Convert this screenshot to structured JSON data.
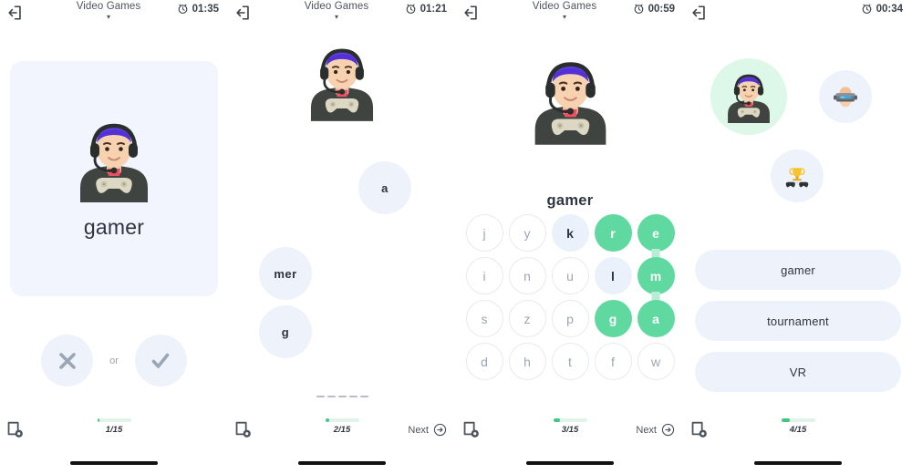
{
  "accent": {
    "green": "#5fd9a0",
    "green_dark": "#3ec87f",
    "green_light": "#ddf7e9",
    "blue_light": "#eef3fb",
    "card_blue": "#f2f5fd",
    "text_dark": "#2e3440",
    "text_muted": "#9aa6b5"
  },
  "screens": [
    {
      "id": "flashcard-screen",
      "header": {
        "exit_icon": "exit-icon",
        "title": "Video Games",
        "caret_icon": "chevron-down-icon",
        "clock_icon": "alarm-clock-icon",
        "timer": "01:35"
      },
      "card": {
        "word": "gamer",
        "avatar_icon": "gamer-avatar"
      },
      "choices": {
        "reject_icon": "close-icon",
        "or_label": "or",
        "accept_icon": "check-icon"
      },
      "footer": {
        "card_settings_icon": "card-settings-icon",
        "progress_label": "1/15",
        "progress_percent": 7,
        "next_label": "",
        "next_icon": "arrow-right-circle-icon",
        "show_next": false
      }
    },
    {
      "id": "word-bubbles-screen",
      "header": {
        "exit_icon": "exit-icon",
        "title": "Video Games",
        "caret_icon": "chevron-down-icon",
        "clock_icon": "alarm-clock-icon",
        "timer": "01:21"
      },
      "avatar_icon": "gamer-avatar",
      "bubbles": [
        {
          "label": "a"
        },
        {
          "label": "mer"
        },
        {
          "label": "g"
        }
      ],
      "dash_count": 5,
      "footer": {
        "card_settings_icon": "card-settings-icon",
        "progress_label": "2/15",
        "progress_percent": 13,
        "next_label": "Next",
        "next_icon": "arrow-right-circle-icon",
        "show_next": true
      }
    },
    {
      "id": "letter-grid-screen",
      "header": {
        "exit_icon": "exit-icon",
        "title": "Video Games",
        "caret_icon": "chevron-down-icon",
        "clock_icon": "alarm-clock-icon",
        "timer": "00:59"
      },
      "avatar_icon": "gamer-avatar",
      "word": "gamer",
      "grid": [
        [
          {
            "letter": "j",
            "state": "plain"
          },
          {
            "letter": "y",
            "state": "plain"
          },
          {
            "letter": "k",
            "state": "hover"
          },
          {
            "letter": "r",
            "state": "sel"
          },
          {
            "letter": "e",
            "state": "sel",
            "link_down": true
          }
        ],
        [
          {
            "letter": "i",
            "state": "plain"
          },
          {
            "letter": "n",
            "state": "plain"
          },
          {
            "letter": "u",
            "state": "plain"
          },
          {
            "letter": "l",
            "state": "hover"
          },
          {
            "letter": "m",
            "state": "sel",
            "link_down": true
          }
        ],
        [
          {
            "letter": "s",
            "state": "plain"
          },
          {
            "letter": "z",
            "state": "plain"
          },
          {
            "letter": "p",
            "state": "plain"
          },
          {
            "letter": "g",
            "state": "sel"
          },
          {
            "letter": "a",
            "state": "sel"
          }
        ],
        [
          {
            "letter": "d",
            "state": "plain"
          },
          {
            "letter": "h",
            "state": "plain"
          },
          {
            "letter": "t",
            "state": "plain"
          },
          {
            "letter": "f",
            "state": "plain"
          },
          {
            "letter": "w",
            "state": "plain"
          }
        ]
      ],
      "footer": {
        "card_settings_icon": "card-settings-icon",
        "progress_label": "3/15",
        "progress_percent": 20,
        "next_label": "Next",
        "next_icon": "arrow-right-circle-icon",
        "show_next": true
      }
    },
    {
      "id": "multiple-choice-screen",
      "header": {
        "exit_icon": "exit-icon",
        "title": "",
        "caret_icon": "",
        "clock_icon": "alarm-clock-icon",
        "timer": "00:34"
      },
      "options": [
        {
          "icon": "gamer-avatar",
          "state": "selected"
        },
        {
          "icon": "vr-headset-avatar",
          "state": "default"
        },
        {
          "icon": "trophy-controllers-avatar",
          "state": "default"
        }
      ],
      "answers": [
        {
          "label": "gamer"
        },
        {
          "label": "tournament"
        },
        {
          "label": "VR"
        }
      ],
      "footer": {
        "card_settings_icon": "card-settings-icon",
        "progress_label": "4/15",
        "progress_percent": 27,
        "next_label": "",
        "next_icon": "arrow-right-circle-icon",
        "show_next": false
      }
    }
  ]
}
